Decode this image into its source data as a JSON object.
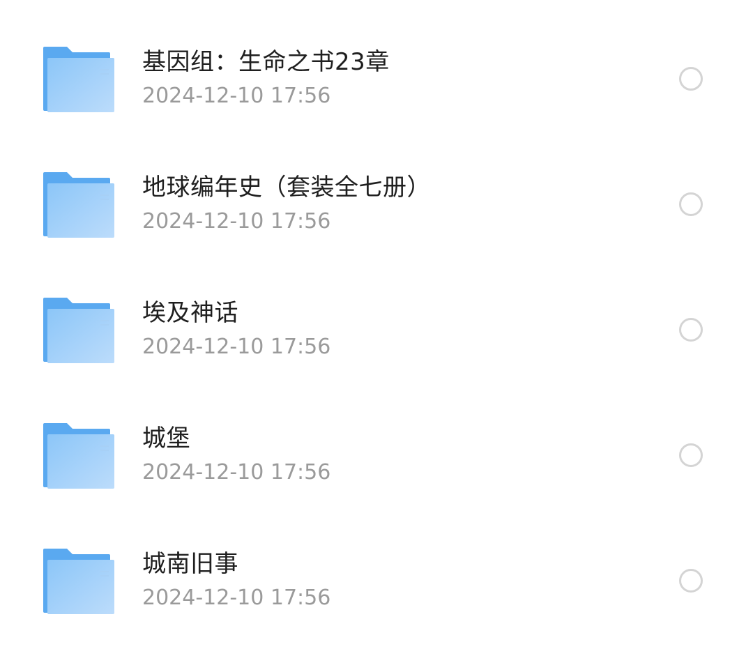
{
  "files": [
    {
      "name": "基因组：生命之书23章",
      "date": "2024-12-10 17:56",
      "icon": "folder-icon",
      "selected": false
    },
    {
      "name": "地球编年史（套装全七册）",
      "date": "2024-12-10 17:56",
      "icon": "folder-icon",
      "selected": false
    },
    {
      "name": "埃及神话",
      "date": "2024-12-10 17:56",
      "icon": "folder-icon",
      "selected": false
    },
    {
      "name": "城堡",
      "date": "2024-12-10 17:56",
      "icon": "folder-icon",
      "selected": false
    },
    {
      "name": "城南旧事",
      "date": "2024-12-10 17:56",
      "icon": "folder-icon",
      "selected": false
    }
  ],
  "colors": {
    "folder_back": "#5aa9f0",
    "folder_front_top": "#8cc6f8",
    "folder_front_bottom": "#b8dbfb",
    "title_text": "#1f1f1f",
    "date_text": "#9a9a9a",
    "radio_border": "#d4d4d4"
  }
}
